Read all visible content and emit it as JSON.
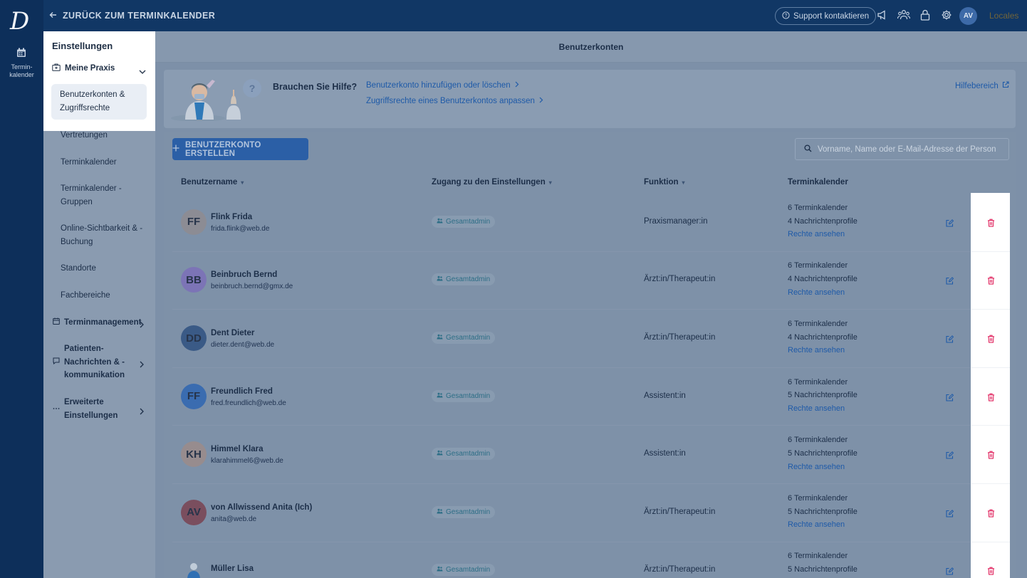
{
  "rail": {
    "logo": "D",
    "calendar_label": "Termin-\nkalender"
  },
  "topbar": {
    "back_label": "ZURÜCK ZUM TERMINKALENDER",
    "support_label": "Support kontaktieren",
    "avatar_initials": "AV",
    "locales_label": "Locales"
  },
  "sidebar": {
    "title": "Einstellungen",
    "group_label": "Meine Praxis",
    "active_item": "Benutzerkonten & Zugriffsrechte",
    "items": [
      "Vertretungen",
      "Terminkalender",
      "Terminkalender - Gruppen",
      "Online-Sichtbarkeit & -Buchung",
      "Standorte",
      "Fachbereiche"
    ],
    "categories": [
      "Terminmanagement",
      "Patienten-Nachrichten & -kommunikation",
      "Erweiterte Einstellungen"
    ]
  },
  "main": {
    "title": "Benutzerkonten",
    "help": {
      "title": "Brauchen Sie Hilfe?",
      "links": [
        "Benutzerkonto hinzufügen oder löschen",
        "Zugriffsrechte eines Benutzerkontos anpassen"
      ],
      "help_area": "Hilfebereich"
    },
    "create_button": "BENUTZERKONTO ERSTELLEN",
    "search_placeholder": "Vorname, Name oder E-Mail-Adresse der Person",
    "columns": [
      "Benutzername",
      "Zugang zu den Einstellungen",
      "Funktion",
      "Terminkalender"
    ],
    "rows": [
      {
        "initials": "FF",
        "name": "Flink Frida",
        "email": "frida.flink@web.de",
        "access": "Gesamtadmin",
        "function": "Praxismanager:in",
        "calendars": "6 Terminkalender",
        "profiles": "4 Nachrichtenprofile",
        "rights": "Rechte ansehen",
        "avatar_color": "#8c8c94"
      },
      {
        "initials": "BB",
        "name": "Beinbruch Bernd",
        "email": "beinbruch.bernd@gmx.de",
        "access": "Gesamtadmin",
        "function": "Ärzt:in/Therapeut:in",
        "calendars": "6 Terminkalender",
        "profiles": "4 Nachrichtenprofile",
        "rights": "Rechte ansehen",
        "avatar_color": "#7c74b6"
      },
      {
        "initials": "DD",
        "name": "Dent Dieter",
        "email": "dieter.dent@web.de",
        "access": "Gesamtadmin",
        "function": "Ärzt:in/Therapeut:in",
        "calendars": "6 Terminkalender",
        "profiles": "4 Nachrichtenprofile",
        "rights": "Rechte ansehen",
        "avatar_color": "#3a5a86"
      },
      {
        "initials": "FF",
        "name": "Freundlich Fred",
        "email": "fred.freundlich@web.de",
        "access": "Gesamtadmin",
        "function": "Assistent:in",
        "calendars": "6 Terminkalender",
        "profiles": "5 Nachrichtenprofile",
        "rights": "Rechte ansehen",
        "avatar_color": "#3a6cb0"
      },
      {
        "initials": "KH",
        "name": "Himmel Klara",
        "email": "klarahimmel6@web.de",
        "access": "Gesamtadmin",
        "function": "Assistent:in",
        "calendars": "6 Terminkalender",
        "profiles": "5 Nachrichtenprofile",
        "rights": "Rechte ansehen",
        "avatar_color": "#978c8e"
      },
      {
        "initials": "AV",
        "name": "von Allwissend Anita (Ich)",
        "email": "anita@web.de",
        "access": "Gesamtadmin",
        "function": "Ärzt:in/Therapeut:in",
        "calendars": "6 Terminkalender",
        "profiles": "5 Nachrichtenprofile",
        "rights": "Rechte ansehen",
        "avatar_color": "#7a4e5e"
      },
      {
        "initials": "",
        "name": "Müller Lisa",
        "email": "",
        "access": "Gesamtadmin",
        "function": "Ärzt:in/Therapeut:in",
        "calendars": "6 Terminkalender",
        "profiles": "5 Nachrichtenprofile",
        "rights": "",
        "avatar_color": "#7e91a8"
      }
    ]
  },
  "colors": {
    "rail": "#0d2f5a",
    "topbar": "#113765",
    "link": "#1e5aa8",
    "delete": "#e0245e",
    "badge_text": "#2d6e86"
  }
}
